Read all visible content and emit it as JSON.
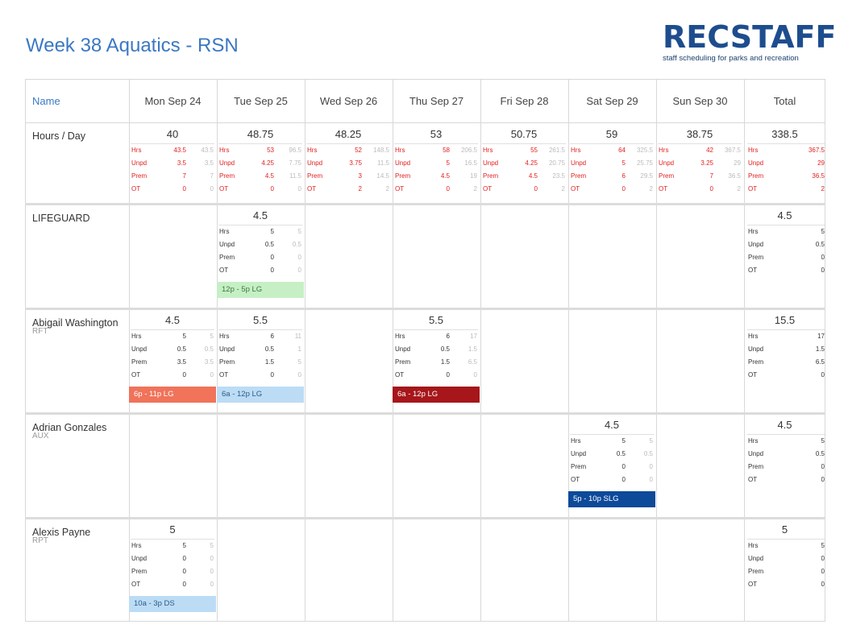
{
  "title": "Week 38 Aquatics - RSN",
  "logo": {
    "main": "RECSTAFF",
    "sub": "staff scheduling for parks and recreation"
  },
  "header": {
    "name_label": "Name",
    "days": [
      "Mon Sep 24",
      "Tue Sep 25",
      "Wed Sep 26",
      "Thu Sep 27",
      "Fri Sep 28",
      "Sat Sep 29",
      "Sun Sep 30"
    ],
    "total_label": "Total"
  },
  "hours_row": {
    "label": "Hours / Day",
    "days": [
      {
        "total": "40",
        "hrs": "43.5",
        "hrs_c": "43.5",
        "unpd": "3.5",
        "unpd_c": "3.5",
        "prem": "7",
        "prem_c": "7",
        "ot": "0",
        "ot_c": "0"
      },
      {
        "total": "48.75",
        "hrs": "53",
        "hrs_c": "96.5",
        "unpd": "4.25",
        "unpd_c": "7.75",
        "prem": "4.5",
        "prem_c": "11.5",
        "ot": "0",
        "ot_c": "0"
      },
      {
        "total": "48.25",
        "hrs": "52",
        "hrs_c": "148.5",
        "unpd": "3.75",
        "unpd_c": "11.5",
        "prem": "3",
        "prem_c": "14.5",
        "ot": "2",
        "ot_c": "2"
      },
      {
        "total": "53",
        "hrs": "58",
        "hrs_c": "206.5",
        "unpd": "5",
        "unpd_c": "16.5",
        "prem": "4.5",
        "prem_c": "19",
        "ot": "0",
        "ot_c": "2"
      },
      {
        "total": "50.75",
        "hrs": "55",
        "hrs_c": "261.5",
        "unpd": "4.25",
        "unpd_c": "20.75",
        "prem": "4.5",
        "prem_c": "23.5",
        "ot": "0",
        "ot_c": "2"
      },
      {
        "total": "59",
        "hrs": "64",
        "hrs_c": "325.5",
        "unpd": "5",
        "unpd_c": "25.75",
        "prem": "6",
        "prem_c": "29.5",
        "ot": "0",
        "ot_c": "2"
      },
      {
        "total": "38.75",
        "hrs": "42",
        "hrs_c": "367.5",
        "unpd": "3.25",
        "unpd_c": "29",
        "prem": "7",
        "prem_c": "36.5",
        "ot": "0",
        "ot_c": "2"
      }
    ],
    "total": {
      "total": "338.5",
      "hrs": "367.5",
      "unpd": "29",
      "prem": "36.5",
      "ot": "2"
    }
  },
  "stat_labels": {
    "hrs": "Hrs",
    "unpd": "Unpd",
    "prem": "Prem",
    "ot": "OT"
  },
  "rows": [
    {
      "name": "LIFEGUARD",
      "role": "",
      "cells": [
        {
          "day": 1,
          "total": "4.5",
          "hrs": "5",
          "hrs_c": "5",
          "unpd": "0.5",
          "unpd_c": "0.5",
          "prem": "0",
          "prem_c": "0",
          "ot": "0",
          "ot_c": "0",
          "shift": "12p - 5p LG",
          "color": "#c6efc6",
          "text_color": "#3a7a3a"
        }
      ],
      "total": {
        "total": "4.5",
        "hrs": "5",
        "unpd": "0.5",
        "prem": "0",
        "ot": "0"
      }
    },
    {
      "name": "Abigail Washington",
      "role": "RFT",
      "cells": [
        {
          "day": 0,
          "total": "4.5",
          "hrs": "5",
          "hrs_c": "5",
          "unpd": "0.5",
          "unpd_c": "0.5",
          "prem": "3.5",
          "prem_c": "3.5",
          "ot": "0",
          "ot_c": "0",
          "shift": "6p - 11p LG",
          "color": "#f0735a",
          "text_color": "#ffffff"
        },
        {
          "day": 1,
          "total": "5.5",
          "hrs": "6",
          "hrs_c": "11",
          "unpd": "0.5",
          "unpd_c": "1",
          "prem": "1.5",
          "prem_c": "5",
          "ot": "0",
          "ot_c": "0",
          "shift": "6a - 12p LG",
          "color": "#bcdcf6",
          "text_color": "#2c5a85"
        },
        {
          "day": 3,
          "total": "5.5",
          "hrs": "6",
          "hrs_c": "17",
          "unpd": "0.5",
          "unpd_c": "1.5",
          "prem": "1.5",
          "prem_c": "6.5",
          "ot": "0",
          "ot_c": "0",
          "shift": "6a - 12p LG",
          "color": "#a6161a",
          "text_color": "#ffffff"
        }
      ],
      "total": {
        "total": "15.5",
        "hrs": "17",
        "unpd": "1.5",
        "prem": "6.5",
        "ot": "0"
      }
    },
    {
      "name": "Adrian Gonzales",
      "role": "AUX",
      "cells": [
        {
          "day": 5,
          "total": "4.5",
          "hrs": "5",
          "hrs_c": "5",
          "unpd": "0.5",
          "unpd_c": "0.5",
          "prem": "0",
          "prem_c": "0",
          "ot": "0",
          "ot_c": "0",
          "shift": "5p - 10p SLG",
          "color": "#0d4a9a",
          "text_color": "#ffffff"
        }
      ],
      "total": {
        "total": "4.5",
        "hrs": "5",
        "unpd": "0.5",
        "prem": "0",
        "ot": "0"
      }
    },
    {
      "name": "Alexis Payne",
      "role": "RPT",
      "cells": [
        {
          "day": 0,
          "total": "5",
          "hrs": "5",
          "hrs_c": "5",
          "unpd": "0",
          "unpd_c": "0",
          "prem": "0",
          "prem_c": "0",
          "ot": "0",
          "ot_c": "0",
          "shift": "10a - 3p DS",
          "color": "#bcdcf6",
          "text_color": "#2c5a85"
        }
      ],
      "total": {
        "total": "5",
        "hrs": "5",
        "unpd": "0",
        "prem": "0",
        "ot": "0"
      }
    }
  ],
  "colors": {
    "accent": "#3b78c3",
    "logo": "#1d4d8e",
    "red": "#e02020"
  }
}
